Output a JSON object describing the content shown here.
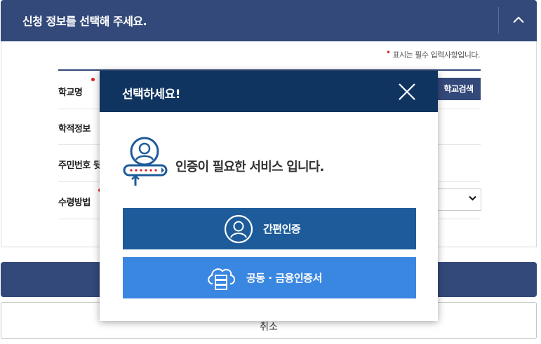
{
  "header": {
    "title": "신청 정보를 선택해 주세요."
  },
  "form": {
    "required_note": "표시는 필수 입력사항입니다.",
    "rows": [
      {
        "label": "학교명"
      },
      {
        "label": "학적정보"
      },
      {
        "label": "주민번호 뒷"
      },
      {
        "label": "수령방법"
      }
    ],
    "school_search_button": "학교검색"
  },
  "cancel": {
    "label": "취소"
  },
  "modal": {
    "title": "선택하세요!",
    "message": "인증이 필요한 서비스 입니다.",
    "simple_auth_label": "간편인증",
    "joint_cert_label": "공동 · 금융인증서"
  },
  "colors": {
    "navy": "#33497a",
    "modal_header": "#0f3460",
    "simple_auth": "#1d5b9a",
    "joint_cert": "#3a87e2",
    "required": "#e51c23"
  },
  "icons": [
    "chevron-up-icon",
    "chevron-down-icon",
    "close-icon",
    "user-certificate-icon",
    "user-circle-icon",
    "cloud-server-icon"
  ]
}
